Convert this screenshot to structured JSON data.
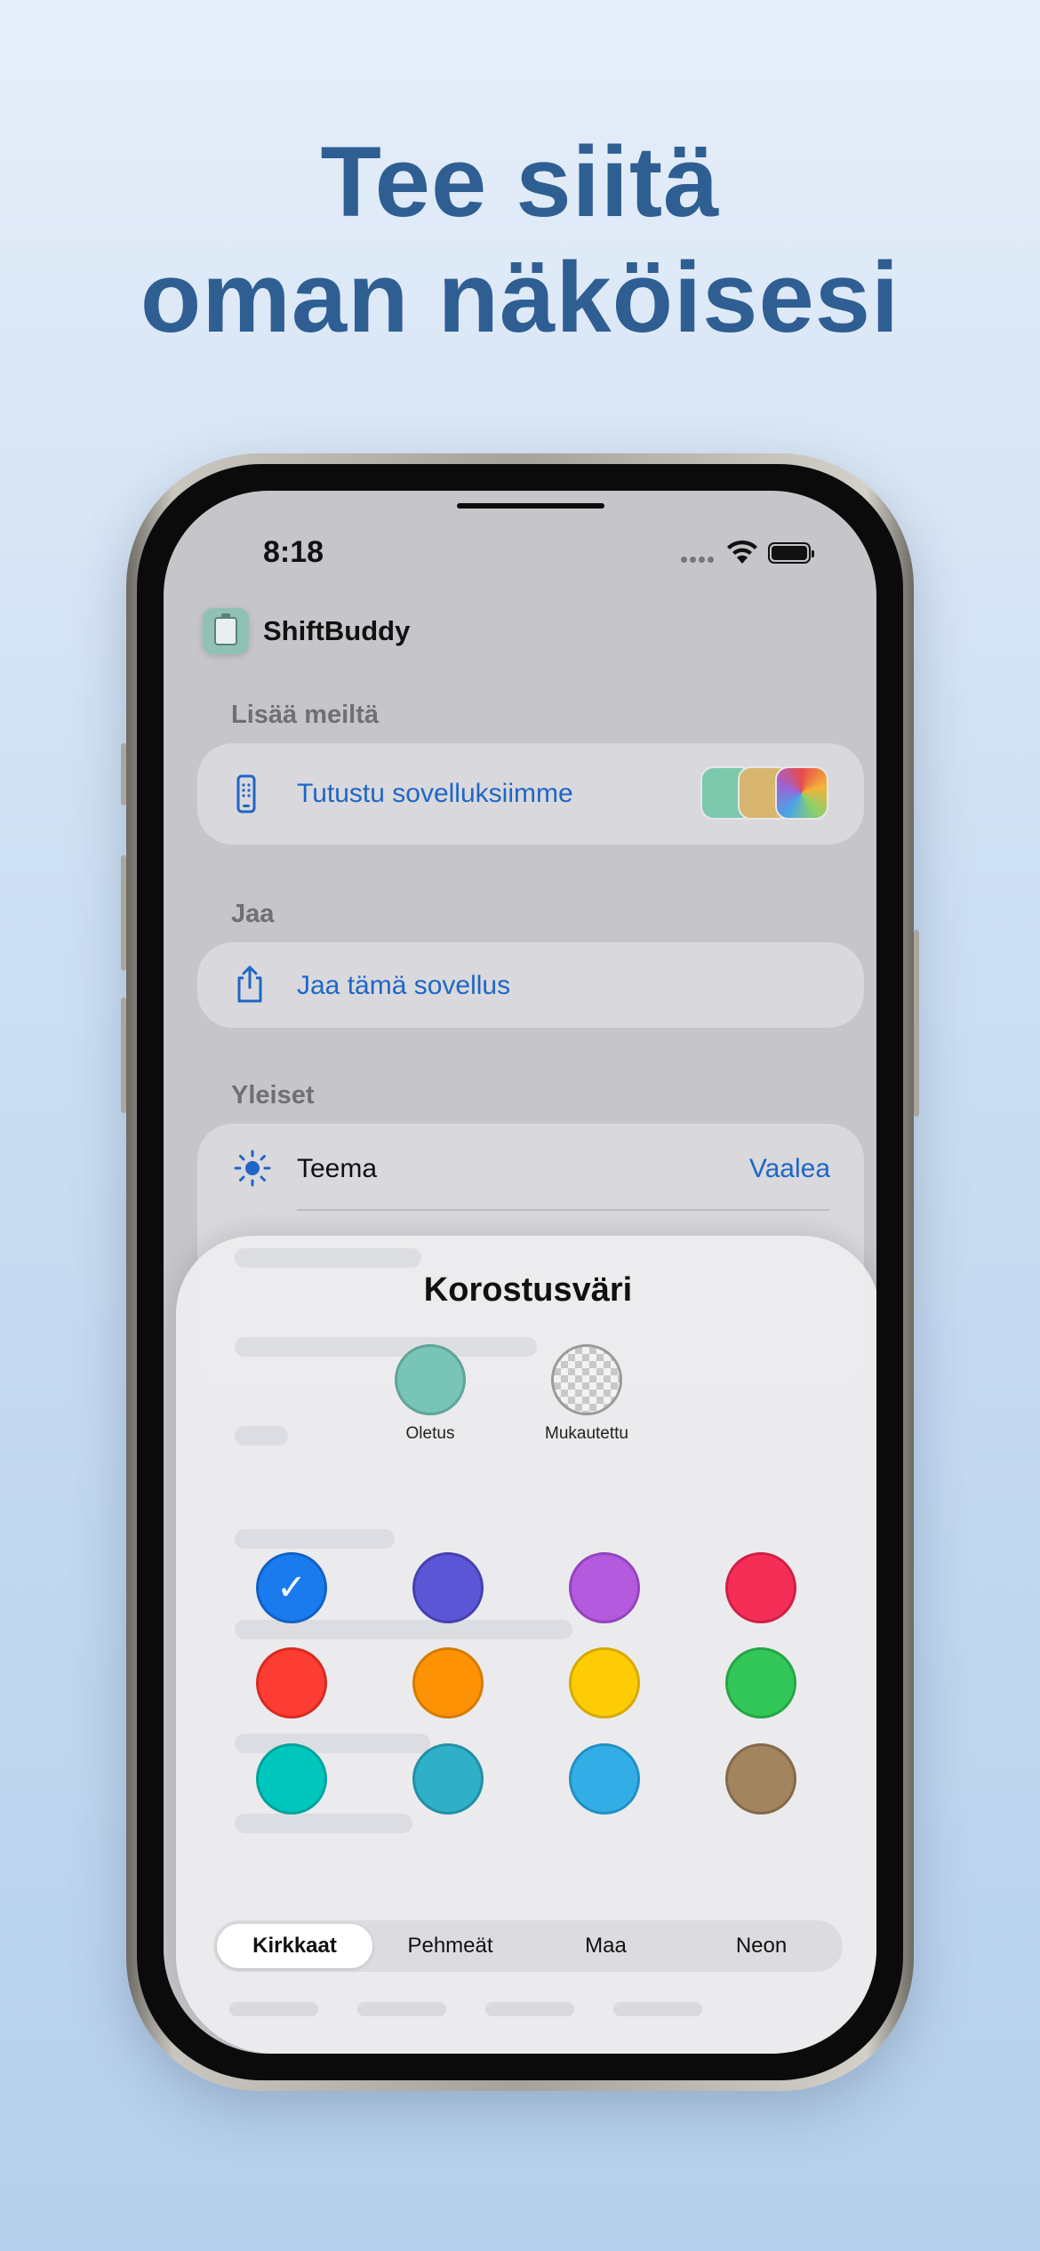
{
  "headline": {
    "line1": "Tee siitä",
    "line2": "oman näköisesi"
  },
  "status_bar": {
    "time": "8:18"
  },
  "app": {
    "name": "ShiftBuddy"
  },
  "sections": {
    "more": {
      "label": "Lisää meiltä",
      "row_label": "Tutustu sovelluksiimme"
    },
    "share": {
      "label": "Jaa",
      "row_label": "Jaa tämä sovellus"
    },
    "general": {
      "label": "Yleiset",
      "theme_label": "Teema",
      "theme_value": "Vaalea"
    }
  },
  "accent_sheet": {
    "title": "Korostusväri",
    "presets": [
      {
        "label": "Oletus",
        "color": "#78c4b6"
      },
      {
        "label": "Mukautettu",
        "color": "checker"
      }
    ],
    "swatches": [
      {
        "name": "blue",
        "color": "#1a7bef",
        "border": "#1161c4",
        "selected": true
      },
      {
        "name": "indigo",
        "color": "#5b56d6",
        "border": "#4641b0",
        "selected": false
      },
      {
        "name": "purple",
        "color": "#b35adf",
        "border": "#9444bd",
        "selected": false
      },
      {
        "name": "pink",
        "color": "#f52e58",
        "border": "#cf1f45",
        "selected": false
      },
      {
        "name": "red",
        "color": "#fd3d33",
        "border": "#d82a21",
        "selected": false
      },
      {
        "name": "orange",
        "color": "#fd9304",
        "border": "#d67a00",
        "selected": false
      },
      {
        "name": "yellow",
        "color": "#fdcc05",
        "border": "#d6aa00",
        "selected": false
      },
      {
        "name": "green",
        "color": "#33c759",
        "border": "#25a545",
        "selected": false
      },
      {
        "name": "mint",
        "color": "#00c7be",
        "border": "#00a39b",
        "selected": false
      },
      {
        "name": "teal",
        "color": "#30b0c8",
        "border": "#2290a5",
        "selected": false
      },
      {
        "name": "cyan",
        "color": "#33ade6",
        "border": "#2290c4",
        "selected": false
      },
      {
        "name": "brown",
        "color": "#a2845f",
        "border": "#84694a",
        "selected": false
      }
    ],
    "segments": [
      "Kirkkaat",
      "Pehmeät",
      "Maa",
      "Neon"
    ],
    "active_segment": "Kirkkaat"
  }
}
